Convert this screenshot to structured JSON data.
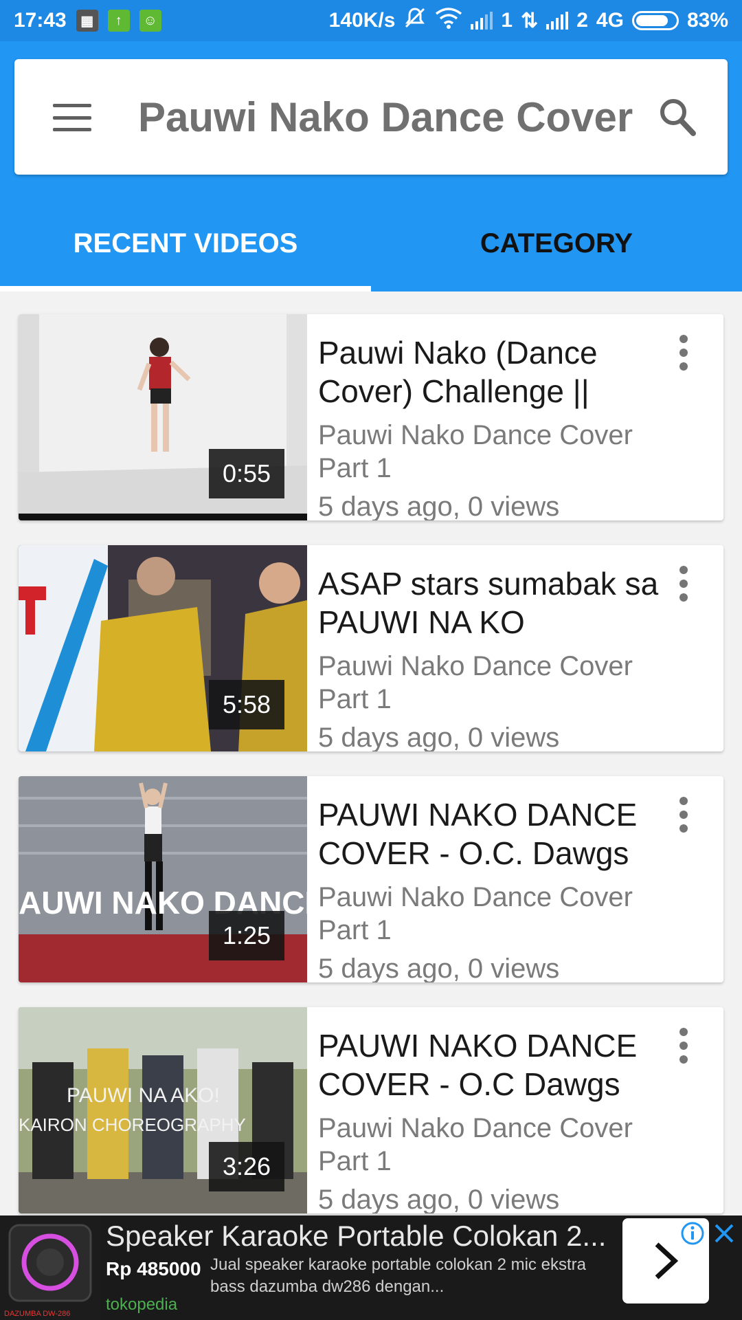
{
  "status_bar": {
    "time": "17:43",
    "speed": "140K/s",
    "sim1": "1",
    "sim2": "2",
    "network": "4G",
    "battery": "83%",
    "battery_level": 0.83
  },
  "header": {
    "title": "Pauwi Nako Dance Cover",
    "menu_icon": "hamburger-menu-icon",
    "search_icon": "search-icon"
  },
  "tabs": [
    {
      "label": "RECENT VIDEOS",
      "active": true
    },
    {
      "label": "CATEGORY",
      "active": false
    }
  ],
  "videos": [
    {
      "title": "Pauwi Nako (Dance Cover) Challenge ||",
      "channel": "Pauwi Nako Dance Cover Part 1",
      "meta": "5 days ago, 0 views",
      "duration": "0:55"
    },
    {
      "title": "ASAP stars sumabak sa PAUWI NA KO",
      "channel": "Pauwi Nako Dance Cover Part 1",
      "meta": "5 days ago, 0 views",
      "duration": "5:58"
    },
    {
      "title": "PAUWI NAKO DANCE COVER - O.C. Dawgs",
      "channel": "Pauwi Nako Dance Cover Part 1",
      "meta": "5 days ago, 0 views",
      "duration": "1:25",
      "thumb_text": "AUWI NAKO DANCE COVE"
    },
    {
      "title": "PAUWI NAKO DANCE COVER - O.C Dawgs",
      "channel": "Pauwi Nako Dance Cover Part 1",
      "meta": "5 days ago, 0 views",
      "duration": "3:26",
      "thumb_text_1": "PAUWI NA AKO!",
      "thumb_text_2": "KAIRON CHOREOGRAPHY"
    }
  ],
  "ad": {
    "title": "Speaker Karaoke Portable Colokan 2...",
    "price": "Rp 485000",
    "description": "Jual speaker karaoke portable colokan 2 mic ekstra bass dazumba dw286 dengan...",
    "source": "tokopedia",
    "product_label": "DAZUMBA DW-286"
  },
  "colors": {
    "primary": "#2196f3",
    "status_bar": "#1e88e5",
    "ad_source": "#4caf50"
  }
}
